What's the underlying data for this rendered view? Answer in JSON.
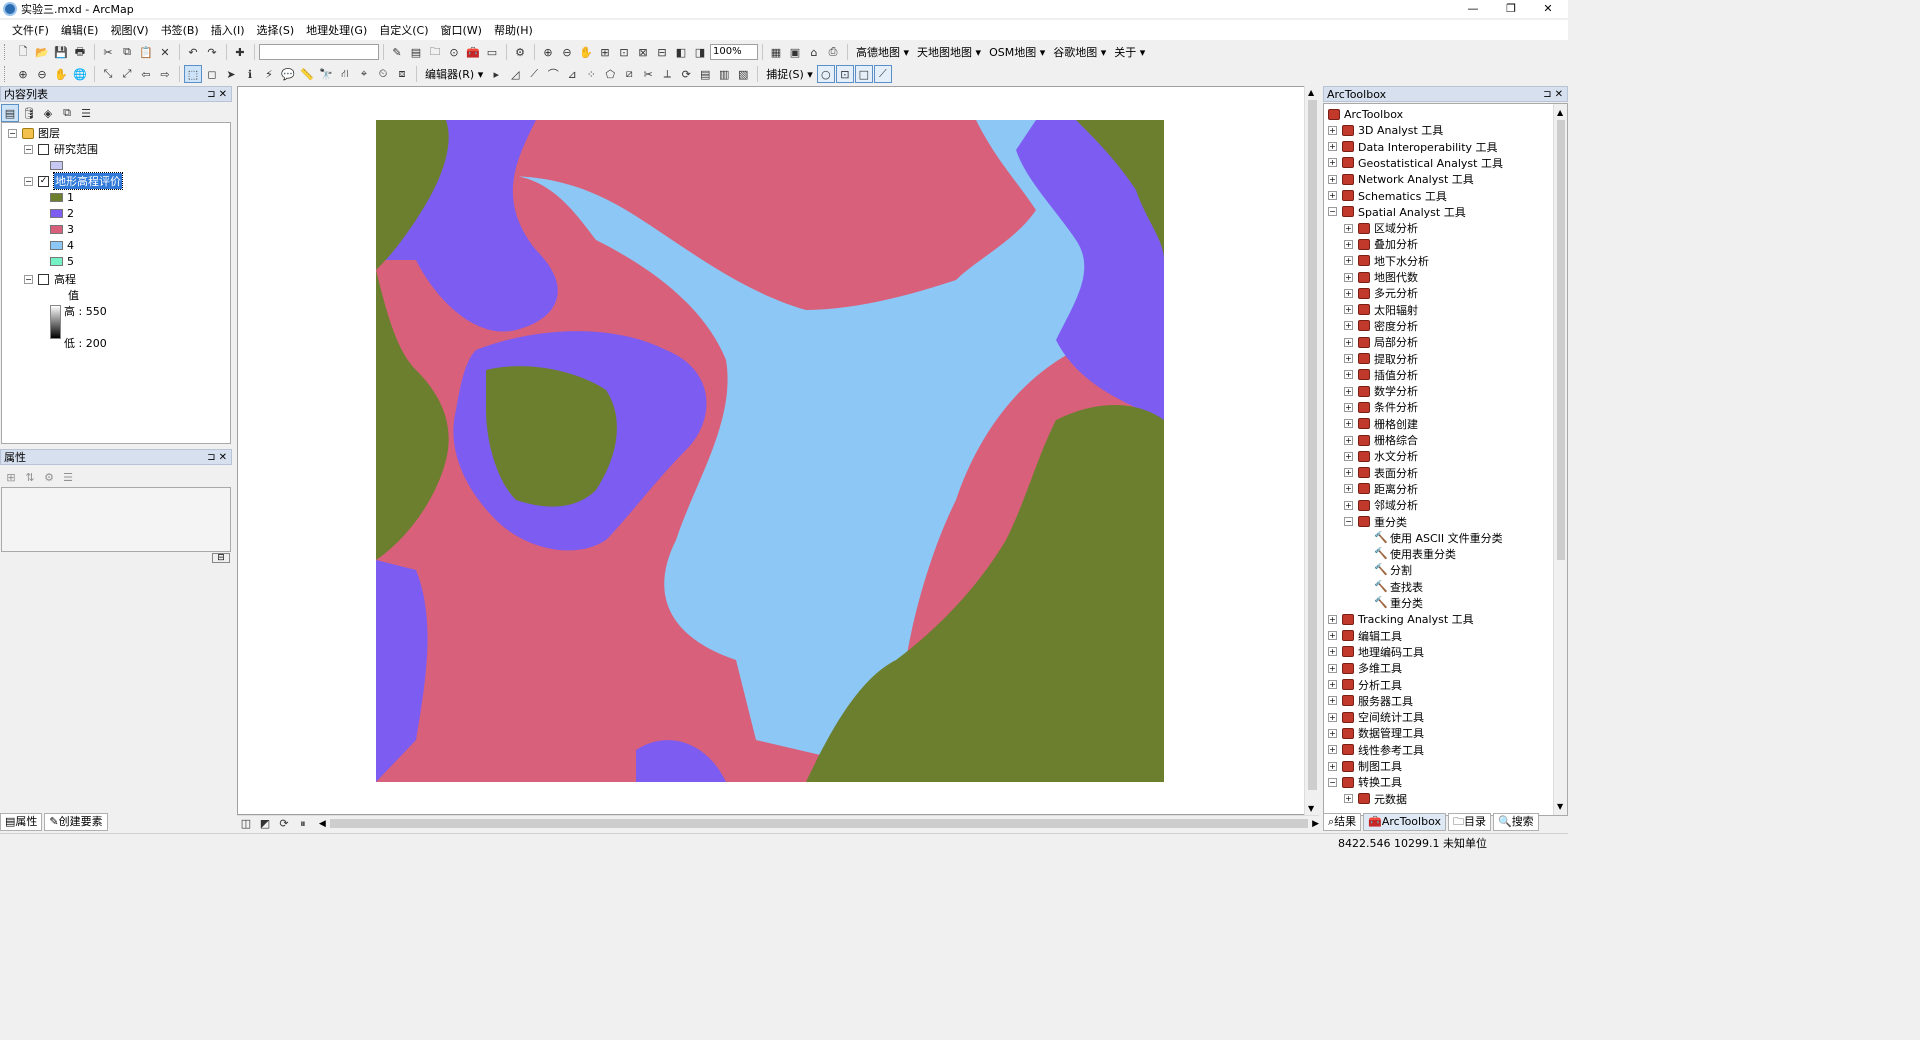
{
  "window": {
    "title": "实验三.mxd - ArcMap",
    "minimize": "—",
    "maximize": "❐",
    "close": "✕"
  },
  "menu": [
    "文件(F)",
    "编辑(E)",
    "视图(V)",
    "书签(B)",
    "插入(I)",
    "选择(S)",
    "地理处理(G)",
    "自定义(C)",
    "窗口(W)",
    "帮助(H)"
  ],
  "toolbar1": {
    "zoom": "100%",
    "basemaps": [
      "高德地图 ▾",
      "天地图地图 ▾",
      "OSM地图 ▾",
      "谷歌地图 ▾",
      "关于 ▾"
    ]
  },
  "toolbar2": {
    "editor": "编辑器(R) ▾",
    "snapping": "捕捉(S) ▾"
  },
  "toc": {
    "title": "内容列表",
    "pin": "⊐ ✕",
    "root": "图层",
    "layers": [
      {
        "name": "研究范围",
        "checked": false
      },
      {
        "name": "地形高程评价",
        "checked": true
      },
      {
        "name": "高程",
        "checked": false
      }
    ],
    "classes": [
      {
        "label": "1",
        "color": "#6b7f2e"
      },
      {
        "label": "2",
        "color": "#7d5cf2"
      },
      {
        "label": "3",
        "color": "#d8607a"
      },
      {
        "label": "4",
        "color": "#8cc7f5"
      },
      {
        "label": "5",
        "color": "#74f2c6"
      }
    ],
    "study_area_color": "#c8c8f5",
    "elevation": {
      "value_label": "值",
      "high": "高 : 550",
      "low": "低 : 200"
    }
  },
  "attributes": {
    "title": "属性",
    "pin": "⊐ ✕"
  },
  "bottom_tabs": [
    "属性",
    "创建要素"
  ],
  "toolbox": {
    "title": "ArcToolbox",
    "pin": "⊐ ✕",
    "root": "ArcToolbox",
    "top_items": [
      "3D Analyst 工具",
      "Data Interoperability 工具",
      "Geostatistical Analyst 工具",
      "Network Analyst 工具",
      "Schematics 工具",
      "Spatial Analyst 工具"
    ],
    "spatial_children": [
      "区域分析",
      "叠加分析",
      "地下水分析",
      "地图代数",
      "多元分析",
      "太阳辐射",
      "密度分析",
      "局部分析",
      "提取分析",
      "插值分析",
      "数学分析",
      "条件分析",
      "栅格创建",
      "栅格综合",
      "水文分析",
      "表面分析",
      "距离分析",
      "邻域分析",
      "重分类"
    ],
    "reclass_tools": [
      "使用 ASCII 文件重分类",
      "使用表重分类",
      "分割",
      "查找表",
      "重分类"
    ],
    "bottom_items": [
      "Tracking Analyst 工具",
      "编辑工具",
      "地理编码工具",
      "多维工具",
      "分析工具",
      "服务器工具",
      "空间统计工具",
      "数据管理工具",
      "线性参考工具",
      "制图工具",
      "转换工具"
    ],
    "conversion_children": [
      "元数据"
    ]
  },
  "toolbox_tabs": [
    "结果",
    "ArcToolbox",
    "目录",
    "搜索"
  ],
  "status": {
    "coords": "8422.546  10299.1 未知单位"
  }
}
